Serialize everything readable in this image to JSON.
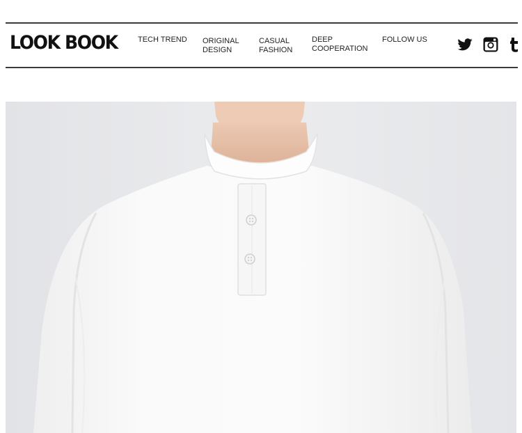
{
  "header": {
    "logo": "LOOK BOOK",
    "nav": [
      {
        "lines": [
          "TECH TREND"
        ]
      },
      {
        "lines": [
          "ORIGINAL",
          "DESIGN"
        ]
      },
      {
        "lines": [
          "CASUAL",
          "FASHION"
        ]
      },
      {
        "lines": [
          "DEEP",
          "COOPERATION"
        ]
      },
      {
        "lines": [
          "FOLLOW US"
        ]
      }
    ],
    "social_icons": [
      "twitter-icon",
      "instagram-icon",
      "tumblr-icon"
    ]
  },
  "hero": {
    "image": "product-photo-white-henley-sweatshirt",
    "colors": {
      "background": "#e6e7ea",
      "shirt": "#f8f8f8",
      "skin": "#e9c7b0"
    }
  }
}
